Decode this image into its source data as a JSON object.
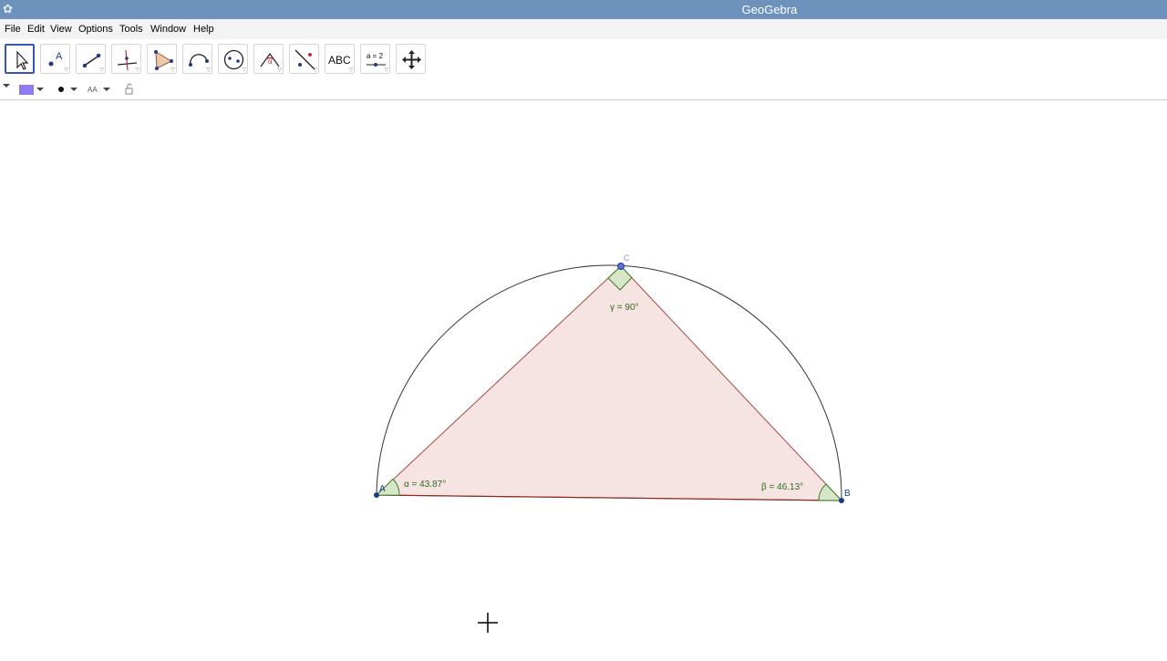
{
  "window": {
    "title": "GeoGebra"
  },
  "menu": [
    "File",
    "Edit",
    "View",
    "Options",
    "Tools",
    "Window",
    "Help"
  ],
  "toolbar": {
    "tools": [
      {
        "name": "move-tool"
      },
      {
        "name": "point-tool",
        "label": "A"
      },
      {
        "name": "line-tool"
      },
      {
        "name": "perpendicular-line-tool"
      },
      {
        "name": "polygon-tool"
      },
      {
        "name": "circle-tool"
      },
      {
        "name": "ellipse-tool"
      },
      {
        "name": "angle-tool",
        "label": "α"
      },
      {
        "name": "reflect-tool"
      },
      {
        "name": "text-tool",
        "label": "ABC"
      },
      {
        "name": "slider-tool",
        "label": "a = 2"
      },
      {
        "name": "move-graphics-view-tool"
      }
    ]
  },
  "stylebar": {
    "color_swatch": "#8e7cf0",
    "text_size_label": "AA"
  },
  "figure": {
    "points": [
      {
        "label": "A"
      },
      {
        "label": "B"
      },
      {
        "label": "C"
      }
    ],
    "angles": {
      "alpha": "α = 43.87°",
      "beta": "β = 46.13°",
      "gamma": "γ = 90°"
    },
    "colors": {
      "triangle_fill": "#f6e4e2",
      "triangle_stroke": "#a34b3f",
      "angle_fill": "#d8e6c8",
      "angle_stroke": "#3d7a2a",
      "point": "#1f3a8a",
      "arc": "#333333"
    }
  }
}
